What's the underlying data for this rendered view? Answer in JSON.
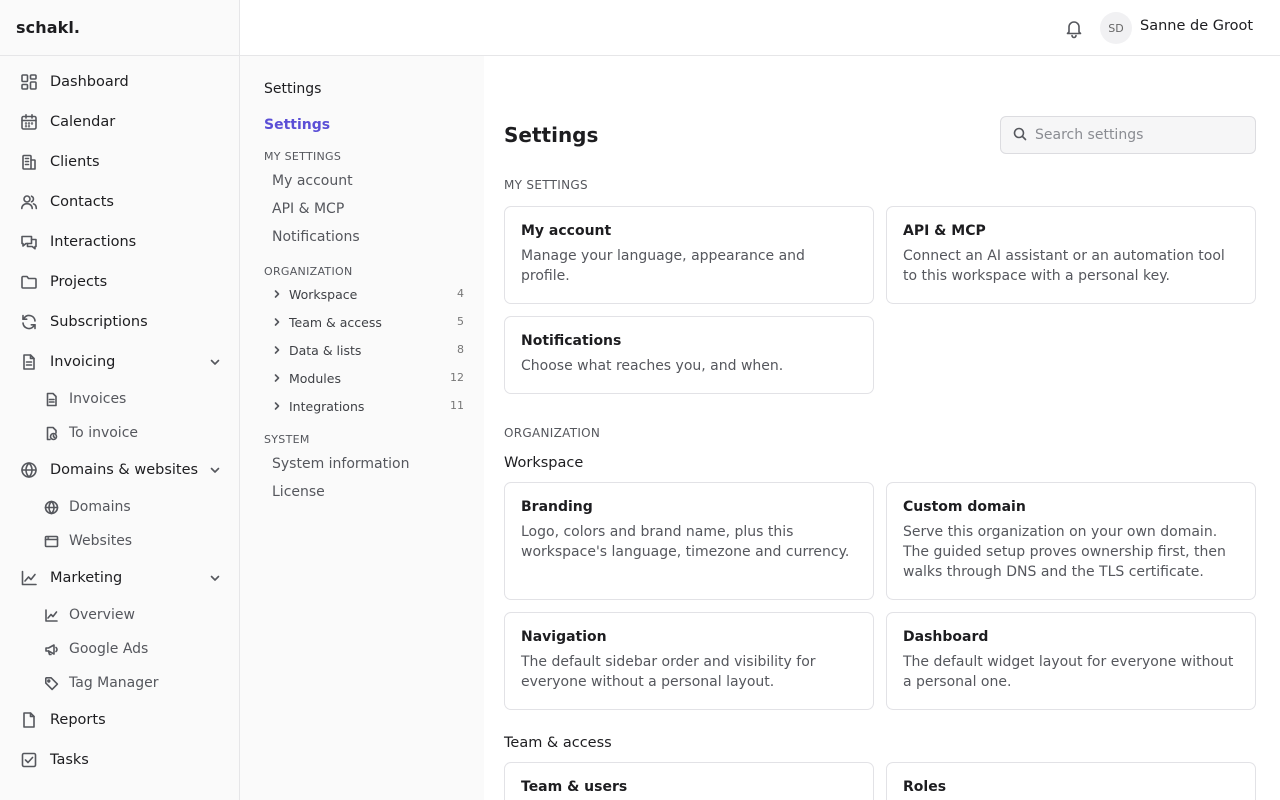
{
  "app": {
    "logo": "schakl."
  },
  "topbar": {
    "avatar_initials": "SD",
    "user_name": "Sanne de Groot"
  },
  "sidebar": {
    "dashboard": "Dashboard",
    "calendar": "Calendar",
    "clients": "Clients",
    "contacts": "Contacts",
    "interactions": "Interactions",
    "projects": "Projects",
    "subscriptions": "Subscriptions",
    "invoicing": "Invoicing",
    "invoices": "Invoices",
    "to_invoice": "To invoice",
    "domains_websites": "Domains & websites",
    "domains": "Domains",
    "websites": "Websites",
    "marketing": "Marketing",
    "overview": "Overview",
    "google_ads": "Google Ads",
    "tag_manager": "Tag Manager",
    "reports": "Reports",
    "tasks": "Tasks"
  },
  "subnav": {
    "heading": "Settings",
    "active": "Settings",
    "my_settings_label": "MY SETTINGS",
    "my_account": "My account",
    "api_mcp": "API & MCP",
    "notifications": "Notifications",
    "organization_label": "ORGANIZATION",
    "groups": [
      {
        "label": "Workspace",
        "count": "4"
      },
      {
        "label": "Team & access",
        "count": "5"
      },
      {
        "label": "Data & lists",
        "count": "8"
      },
      {
        "label": "Modules",
        "count": "12"
      },
      {
        "label": "Integrations",
        "count": "11"
      }
    ],
    "system_label": "SYSTEM",
    "system_information": "System information",
    "license": "License"
  },
  "main": {
    "title": "Settings",
    "search_placeholder": "Search settings",
    "my_settings_label": "MY SETTINGS",
    "organization_label": "ORGANIZATION",
    "workspace_label": "Workspace",
    "team_access_label": "Team & access",
    "cards": {
      "my_account": {
        "title": "My account",
        "desc": "Manage your language, appearance and profile."
      },
      "api_mcp": {
        "title": "API & MCP",
        "desc": "Connect an AI assistant or an automation tool to this workspace with a personal key."
      },
      "notifications": {
        "title": "Notifications",
        "desc": "Choose what reaches you, and when."
      },
      "branding": {
        "title": "Branding",
        "desc": "Logo, colors and brand name, plus this workspace's language, timezone and currency."
      },
      "custom_domain": {
        "title": "Custom domain",
        "desc": "Serve this organization on your own domain. The guided setup proves ownership first, then walks through DNS and the TLS certificate."
      },
      "navigation": {
        "title": "Navigation",
        "desc": "The default sidebar order and visibility for everyone without a personal layout."
      },
      "dashboard": {
        "title": "Dashboard",
        "desc": "The default widget layout for everyone without a personal one."
      },
      "team_users": {
        "title": "Team & users",
        "desc": ""
      },
      "roles": {
        "title": "Roles",
        "desc": ""
      }
    }
  },
  "colors": {
    "accent": "#5b4fd6",
    "border": "#e2e2e6",
    "muted_text": "#55575d"
  }
}
